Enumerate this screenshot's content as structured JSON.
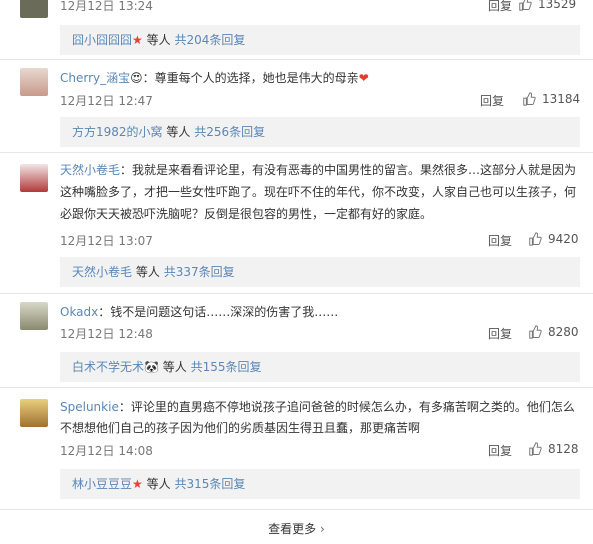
{
  "top_partial": {
    "time": "12月12日 13:24",
    "reply": "回复",
    "likes": "13529"
  },
  "comments": [
    {
      "sub": {
        "names": "囧小囧囧囧",
        "suffix_emoji": "★",
        "mid": "等人",
        "count": "共204条回复"
      }
    },
    {
      "user": "Cherry_涵宝",
      "user_emoji": "😍",
      "text": "尊重每个人的选择，她也是伟大的母亲",
      "text_emoji": "❤",
      "time": "12月12日 12:47",
      "reply": "回复",
      "likes": "13184",
      "sub": {
        "names": "方方1982的小窝",
        "mid": "等人",
        "count": "共256条回复"
      }
    },
    {
      "user": "天然小卷毛",
      "text_line1": "我就是来看看评论里，有没有恶毒的中国男性的留言。果然很多…这部分人就是因为",
      "text_line2": "这种嘴脸多了，才把一些女性吓跑了。现在吓不住的年代，你不改变，人家自己也可以生孩子，何",
      "text_line3": "必跟你天天被恐吓洗脑呢？反倒是很包容的男性，一定都有好的家庭。",
      "time": "12月12日 13:07",
      "reply": "回复",
      "likes": "9420",
      "sub": {
        "names": "天然小卷毛",
        "mid": "等人",
        "count": "共337条回复"
      }
    },
    {
      "user": "Okadx",
      "text": "钱不是问题这句话……深深的伤害了我……",
      "time": "12月12日 12:48",
      "reply": "回复",
      "likes": "8280",
      "sub": {
        "names": "白术不学无术",
        "suffix_emoji": "🐼",
        "mid": "等人",
        "count": "共155条回复"
      }
    },
    {
      "user": "Spelunkie",
      "text_line1": "评论里的直男癌不停地说孩子追问爸爸的时候怎么办，有多痛苦啊之类的。他们怎么",
      "text_line2": "不想想他们自己的孩子因为他们的劣质基因生得丑且蠢，那更痛苦啊",
      "time": "12月12日 14:08",
      "reply": "回复",
      "likes": "8128",
      "sub": {
        "names": "林小豆豆豆",
        "suffix_emoji": "★",
        "mid": "等人",
        "count": "共315条回复"
      }
    }
  ],
  "more": {
    "label": "查看更多",
    "chevron": "›"
  },
  "colors": {
    "link": "#5a87b8",
    "sub_bg": "#f2f2f2",
    "divider": "#e6e6e6"
  }
}
